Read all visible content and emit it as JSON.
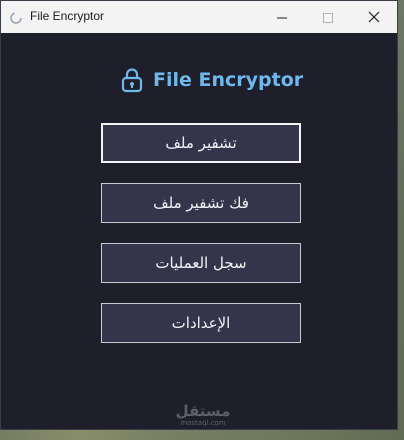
{
  "window": {
    "title": "File Encryptor",
    "app_icon": "app-spinner-icon",
    "controls": [
      "minimize-icon",
      "maximize-icon",
      "close-icon"
    ]
  },
  "header": {
    "title": "File Encryptor",
    "icon": "lock-icon",
    "color": "#6fb8ec"
  },
  "menu": {
    "encrypt_label": "تشفير ملف",
    "decrypt_label": "فك تشفير ملف",
    "log_label": "سجل العمليات",
    "settings_label": "الإعدادات"
  },
  "watermark": {
    "main": "مستقل",
    "sub": "mostaql.com"
  },
  "colors": {
    "background": "#1e1f2b",
    "button": "#34354b",
    "accent": "#6fb8ec"
  }
}
